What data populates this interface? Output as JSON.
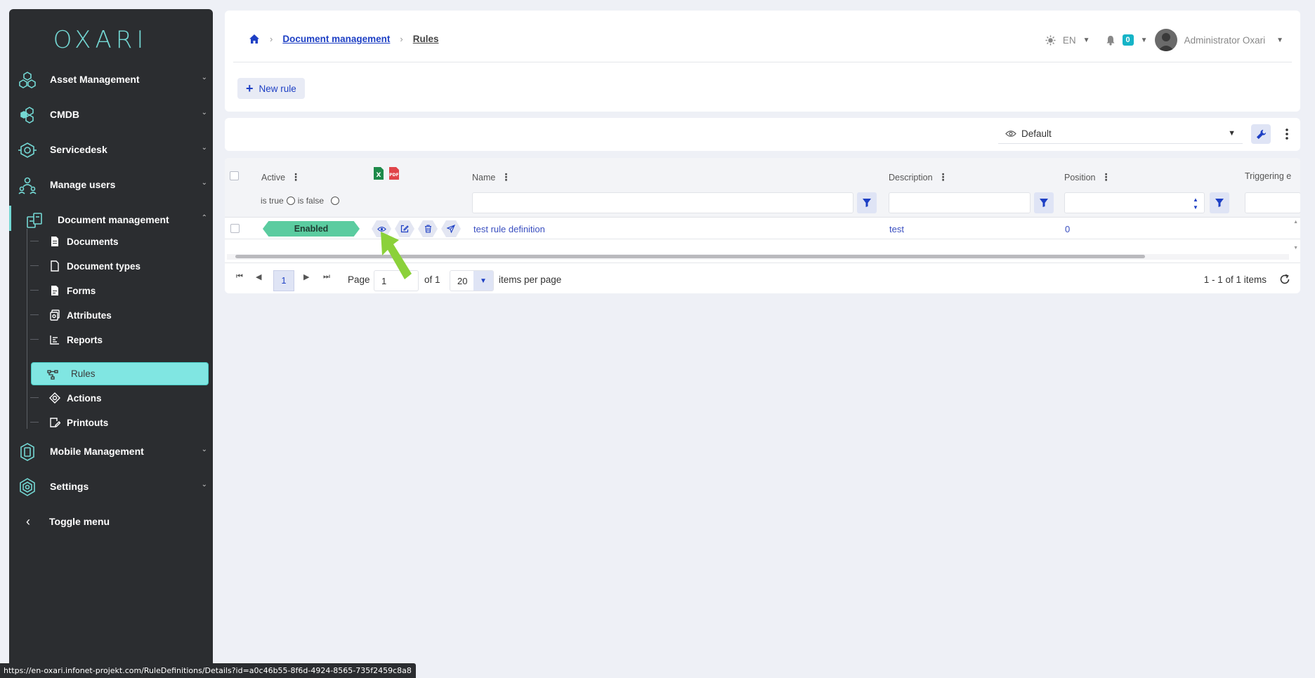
{
  "app": {
    "logo_text": "OXARI"
  },
  "sidebar": {
    "items": [
      {
        "label": "Asset Management",
        "icon": "hexagon-cluster-icon"
      },
      {
        "label": "CMDB",
        "icon": "cmdb-icon"
      },
      {
        "label": "Servicedesk",
        "icon": "servicedesk-icon"
      },
      {
        "label": "Manage users",
        "icon": "users-icon"
      },
      {
        "label": "Document management",
        "icon": "documents-icon"
      },
      {
        "label": "Mobile Management",
        "icon": "mobile-icon"
      },
      {
        "label": "Settings",
        "icon": "gear-icon"
      }
    ],
    "sub_items": [
      {
        "label": "Documents"
      },
      {
        "label": "Document types"
      },
      {
        "label": "Forms"
      },
      {
        "label": "Attributes"
      },
      {
        "label": "Reports"
      },
      {
        "label": "Rules"
      },
      {
        "label": "Actions"
      },
      {
        "label": "Printouts"
      }
    ],
    "toggle_label": "Toggle menu"
  },
  "header": {
    "breadcrumb": {
      "section": "Document management",
      "current": "Rules"
    },
    "language": "EN",
    "notification_count": "0",
    "user_name": "Administrator Oxari",
    "new_rule_label": "New rule"
  },
  "view": {
    "selected": "Default"
  },
  "grid": {
    "columns": {
      "active": "Active",
      "name": "Name",
      "description": "Description",
      "position": "Position",
      "triggering": "Triggering e"
    },
    "radio_true": "is true",
    "radio_false": "is false",
    "rows": [
      {
        "status": "Enabled",
        "name": "test rule definition",
        "description": "test",
        "position": "0"
      }
    ],
    "pager": {
      "current_page": "1",
      "page_label": "Page",
      "page_input": "1",
      "of_label": "of 1",
      "page_size": "20",
      "per_page_label": "items per page",
      "summary": "1 - 1 of 1 items"
    }
  },
  "status_bar": {
    "url": "https://en-oxari.infonet-projekt.com/RuleDefinitions/Details?id=a0c46b55-8f6d-4924-8565-735f2459c8a8"
  },
  "colors": {
    "accent": "#74d8d4",
    "primary": "#1d3fc4",
    "enabled": "#5bcca0",
    "sidebar_bg": "#2b2d30"
  }
}
